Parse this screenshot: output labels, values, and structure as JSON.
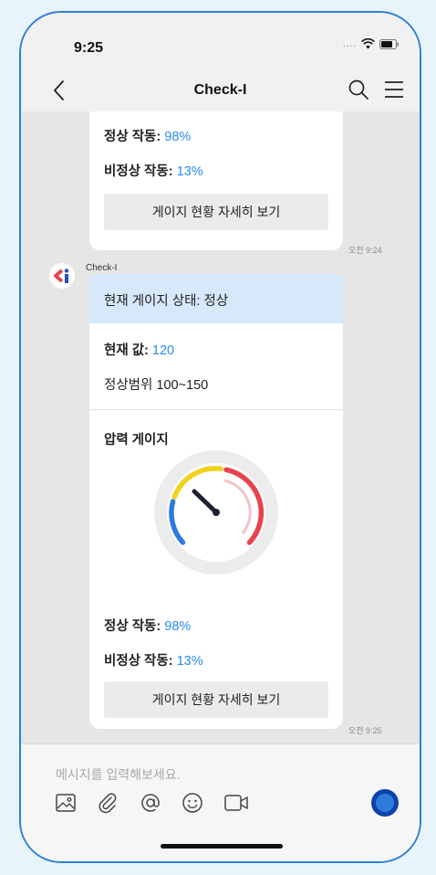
{
  "status": {
    "time": "9:25"
  },
  "nav": {
    "title": "Check-I"
  },
  "messages": {
    "first": {
      "normal_label": "정상 작동:",
      "normal_value": "98%",
      "abnormal_label": "비정상 작동:",
      "abnormal_value": "13%",
      "button_label": "게이지 현황 자세히 보기",
      "time": "오전 9:24"
    },
    "second": {
      "sender": "Check-I",
      "state_title": "현재 게이지 상태: 정상",
      "current_label": "현재 값:",
      "current_value": "120",
      "range_text": "정상범위 100~150",
      "gauge_title": "압력 게이지",
      "normal_label": "정상 작동:",
      "normal_value": "98%",
      "abnormal_label": "비정상 작동:",
      "abnormal_value": "13%",
      "button_label": "게이지 현황 자세히 보기",
      "time": "오전 9:25"
    }
  },
  "composer": {
    "placeholder": "메시지를 입력해보세요.",
    "tools": [
      "image-icon",
      "paperclip-icon",
      "at-sign-icon",
      "emoji-icon",
      "video-icon"
    ]
  },
  "colors": {
    "accent": "#2a8af6",
    "frame": "#2f7fd4",
    "header_blue": "#d7e8fb",
    "gauge_blue": "#2a7be0",
    "gauge_yellow": "#f2d21a",
    "gauge_red": "#e8424f"
  }
}
